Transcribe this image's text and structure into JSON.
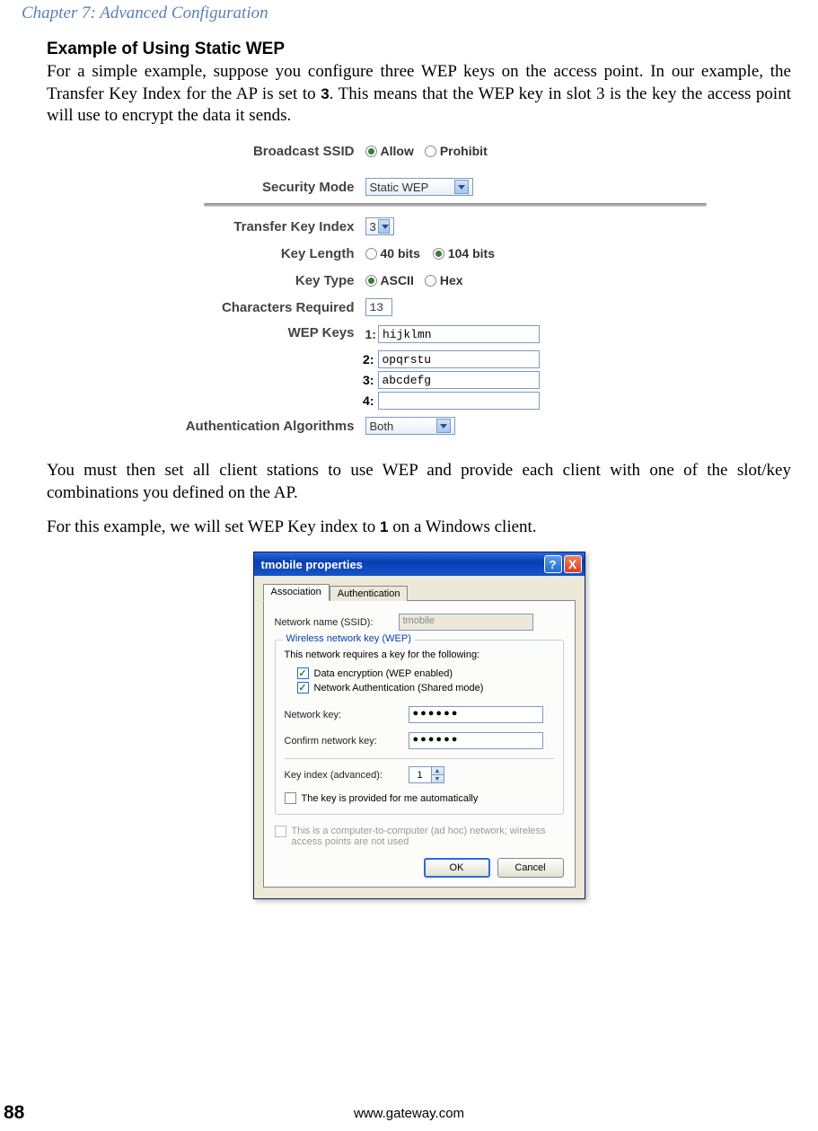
{
  "chapter_header": "Chapter 7: Advanced Configuration",
  "subheading": "Example of Using Static WEP",
  "para1_a": "For a simple example, suppose you configure three WEP keys on the access point. In our example, the Transfer Key Index for the AP is set to ",
  "para1_bold": "3",
  "para1_b": ". This means that the WEP key in slot 3 is the key the access point will use to encrypt the data it sends.",
  "para2": "You must then set all client stations to use WEP and provide each client with one of the slot/key combinations you defined on the AP.",
  "para3_a": "For this example, we will set WEP Key index to ",
  "para3_bold": "1",
  "para3_b": " on a Windows client.",
  "ap": {
    "broadcast_label": "Broadcast SSID",
    "allow": "Allow",
    "prohibit": "Prohibit",
    "security_mode_label": "Security Mode",
    "security_mode_value": "Static WEP",
    "transfer_key_label": "Transfer Key Index",
    "transfer_key_value": "3",
    "key_length_label": "Key Length",
    "key_length_40": "40 bits",
    "key_length_104": "104 bits",
    "key_type_label": "Key Type",
    "key_type_ascii": "ASCII",
    "key_type_hex": "Hex",
    "chars_required_label": "Characters Required",
    "chars_required_value": "13",
    "wep_keys_label": "WEP Keys",
    "key1_num": "1:",
    "key1_val": "hijklmn",
    "key2_num": "2:",
    "key2_val": "opqrstu",
    "key3_num": "3:",
    "key3_val": "abcdefg",
    "key4_num": "4:",
    "key4_val": "",
    "auth_label": "Authentication Algorithms",
    "auth_value": "Both"
  },
  "win": {
    "title": "tmobile properties",
    "help": "?",
    "close": "X",
    "tab_assoc": "Association",
    "tab_auth": "Authentication",
    "ssid_label": "Network name (SSID):",
    "ssid_value": "tmobile",
    "wep_legend": "Wireless network key (WEP)",
    "wep_desc": "This network requires a key for the following:",
    "check1": "Data encryption (WEP enabled)",
    "check2": "Network Authentication (Shared mode)",
    "netkey_label": "Network key:",
    "netkey_value": "●●●●●●",
    "confirm_label": "Confirm network key:",
    "confirm_value": "●●●●●●",
    "keyindex_label": "Key index (advanced):",
    "keyindex_value": "1",
    "auto_label": "The key is provided for me automatically",
    "adhoc_label": "This is a computer-to-computer (ad hoc) network; wireless access points are not used",
    "ok": "OK",
    "cancel": "Cancel"
  },
  "footer": {
    "page_num": "88",
    "url": "www.gateway.com"
  }
}
